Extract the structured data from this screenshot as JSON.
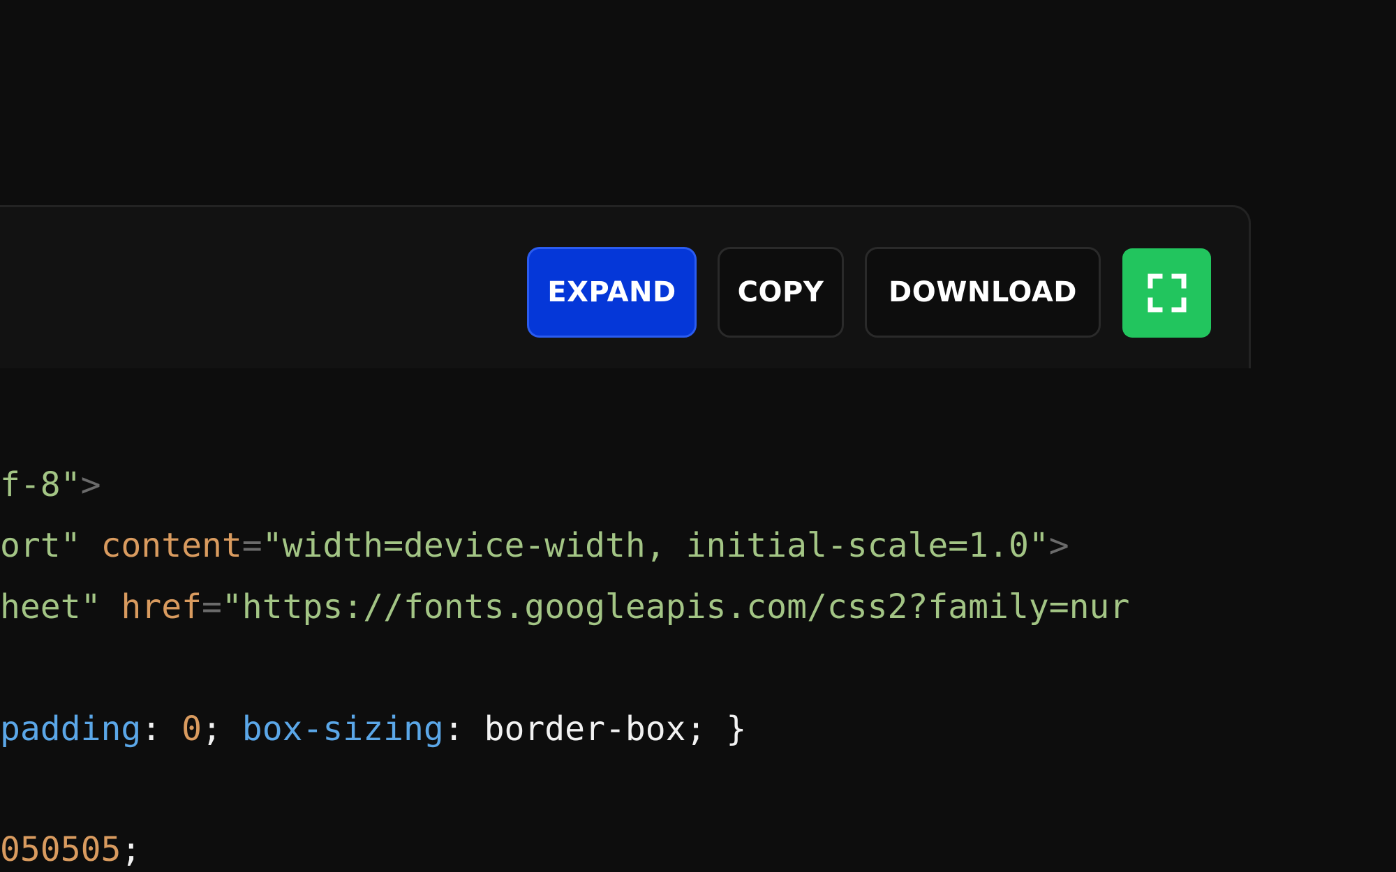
{
  "toolbar": {
    "expand_label": "EXPAND",
    "copy_label": "COPY",
    "download_label": "DOWNLOAD",
    "fullscreen_icon": "fullscreen-icon"
  },
  "colors": {
    "background": "#0d0d0d",
    "panel": "#121212",
    "expand_accent": "#0537d8",
    "fullscreen_accent": "#22c55e",
    "string": "#a3c585",
    "attribute": "#d99b5f",
    "property": "#5ba7e8",
    "punctuation": "#6b6b6b"
  },
  "code": {
    "line1": {
      "string": "f-8\"",
      "punc": ">"
    },
    "line2": {
      "string_a": "ort\"",
      "attr": "content",
      "punc_eq": "=",
      "string_b": "\"width=device-width, initial-scale=1.0\"",
      "punc_end": ">"
    },
    "line3": {
      "string_a": "heet\"",
      "attr": "href",
      "punc_eq": "=",
      "string_b": "\"https://fonts.googleapis.com/css2?family=nur"
    },
    "line4": {
      "prop_a": "padding",
      "sep_a": ": ",
      "num": "0",
      "semi_a": "; ",
      "prop_b": "box-sizing",
      "sep_b": ": ",
      "value": "border-box; }"
    },
    "line5": {
      "num": "050505",
      "semi": ";"
    }
  }
}
